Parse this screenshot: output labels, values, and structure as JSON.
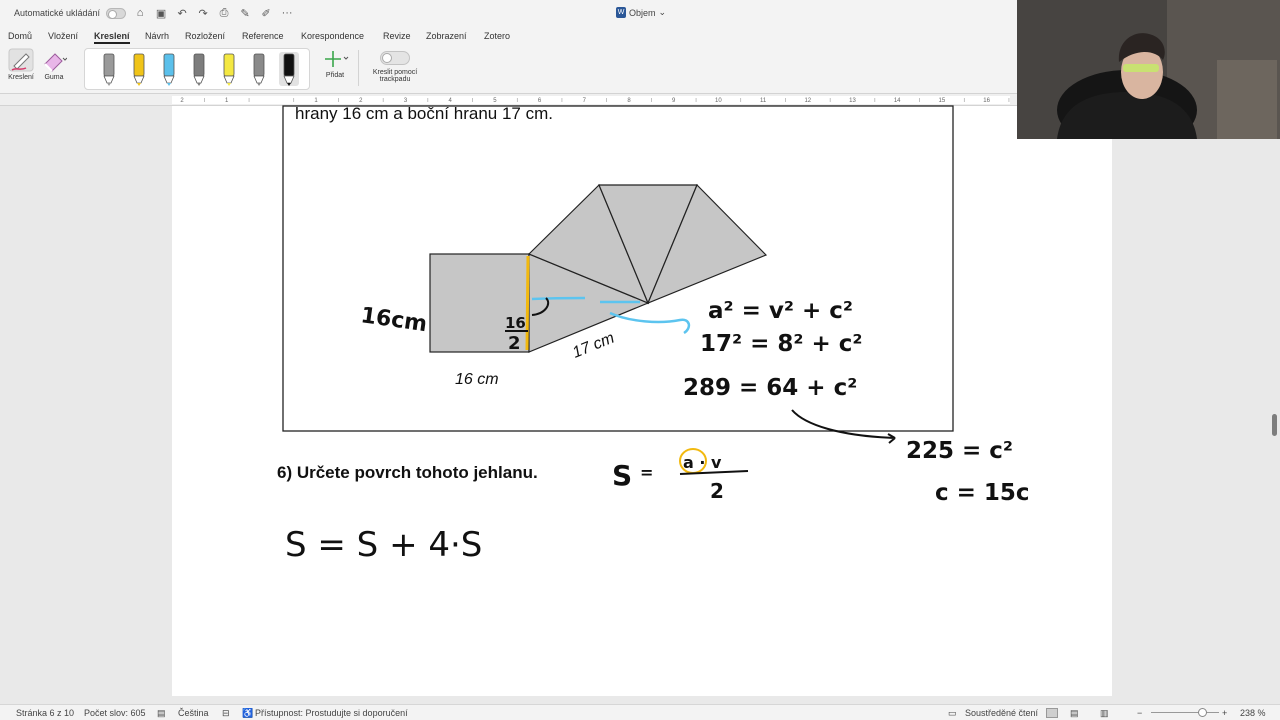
{
  "titlebar": {
    "autosave_label": "Automatické ukládání",
    "doc_title": "Objem",
    "more_label": "···"
  },
  "tabs": [
    {
      "label": "Domů"
    },
    {
      "label": "Vložení"
    },
    {
      "label": "Kreslení"
    },
    {
      "label": "Návrh"
    },
    {
      "label": "Rozložení"
    },
    {
      "label": "Reference"
    },
    {
      "label": "Korespondence"
    },
    {
      "label": "Revize"
    },
    {
      "label": "Zobrazení"
    },
    {
      "label": "Zotero"
    }
  ],
  "ribbon": {
    "draw_label": "Kreslení",
    "eraser_label": "Guma",
    "add_label": "Přidat",
    "trackpad_label_1": "Kreslit pomocí",
    "trackpad_label_2": "trackpadu",
    "pens": [
      {
        "color": "#9a9a9a"
      },
      {
        "color": "#f0c419"
      },
      {
        "color": "#5bc0eb"
      },
      {
        "color": "#7d7d7d"
      },
      {
        "color": "#f4e842"
      },
      {
        "color": "#8a8a8a"
      },
      {
        "color": "#111111"
      }
    ]
  },
  "ruler": {
    "ticks": [
      "2",
      "1",
      "",
      "1",
      "2",
      "3",
      "4",
      "5",
      "6",
      "7",
      "8",
      "9",
      "10",
      "11",
      "12",
      "13",
      "14",
      "15",
      "16"
    ]
  },
  "document": {
    "top_text": "hrany 16 cm a boční hranu 17 cm.",
    "label_16cm": "16 cm",
    "label_17cm": "17 cm",
    "question_6": "6)  Určete povrch tohoto jehlanu.",
    "ink": {
      "side_16": "16cm",
      "frac_num": "16",
      "frac_den": "2",
      "eq1": "a² = v² + c²",
      "eq2": "17² = 8² + c²",
      "eq3": "289 = 64 + c²",
      "eq4": "225 = c²",
      "eq5": "c = 15c",
      "sdelta": "S",
      "sdelta_frac_top": "a · v",
      "sdelta_frac_bot": "2",
      "surface": "S = S + 4·S"
    }
  },
  "statusbar": {
    "page": "Stránka 6 z 10",
    "words": "Počet slov: 605",
    "language": "Čeština",
    "accessibility": "Přístupnost: Prostudujte si doporučení",
    "focus": "Soustředěné čtení",
    "zoom": "238 %"
  },
  "colors": {
    "yellow_ink": "#f2b90f",
    "blue_ink": "#5cc4ef",
    "shape_gray": "#c6c6c6"
  }
}
